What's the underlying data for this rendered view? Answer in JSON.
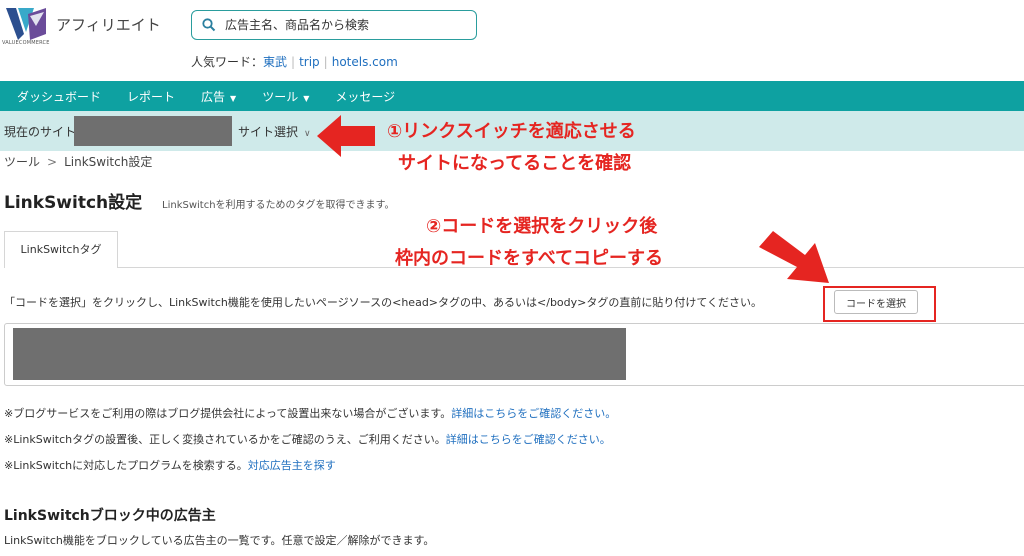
{
  "header": {
    "brand": "アフィリエイト",
    "logo_sub": "VALUECOMMERCE",
    "search_placeholder": "広告主名、商品名から検索",
    "popular_label": "人気ワード：",
    "popular_words": [
      "東武",
      "trip",
      "hotels.com"
    ]
  },
  "nav": {
    "items": [
      {
        "label": "ダッシュボード",
        "has_caret": false
      },
      {
        "label": "レポート",
        "has_caret": false
      },
      {
        "label": "広告",
        "has_caret": true
      },
      {
        "label": "ツール",
        "has_caret": true
      },
      {
        "label": "メッセージ",
        "has_caret": false
      }
    ]
  },
  "site_bar": {
    "label": "現在のサイト",
    "select_label": "サイト選択"
  },
  "annotations": {
    "step1_line1": "①リンクスイッチを適応させる",
    "step1_line2": "サイトになってることを確認",
    "step2_line1": "②コードを選択をクリック後",
    "step2_line2": "枠内のコードをすべてコピーする"
  },
  "breadcrumb": {
    "items": [
      "ツール",
      "LinkSwitch設定"
    ]
  },
  "main": {
    "title": "LinkSwitch設定",
    "description": "LinkSwitchを利用するためのタグを取得できます。",
    "tab_label": "LinkSwitchタグ",
    "instruction": "「コードを選択」をクリックし、LinkSwitch機能を使用したいページソースの<head>タグの中、あるいは</body>タグの直前に貼り付けてください。",
    "code_button": "コードを選択",
    "notes": [
      {
        "text": "※ブログサービスをご利用の際はブログ提供会社によって設置出来ない場合がございます。",
        "link": "詳細はこちらをご確認ください。"
      },
      {
        "text": "※LinkSwitchタグの設置後、正しく変換されているかをご確認のうえ、ご利用ください。",
        "link": "詳細はこちらをご確認ください。"
      },
      {
        "text": "※LinkSwitchに対応したプログラムを検索する。",
        "link": "対応広告主を探す"
      }
    ],
    "block_title": "LinkSwitchブロック中の広告主",
    "block_desc": "LinkSwitch機能をブロックしている広告主の一覧です。任意で設定／解除ができます。"
  },
  "colors": {
    "nav_bg": "#0ea1a1",
    "site_bar_bg": "#cfeaea",
    "annotation_red": "#e52521",
    "link_blue": "#1f6fbf"
  }
}
